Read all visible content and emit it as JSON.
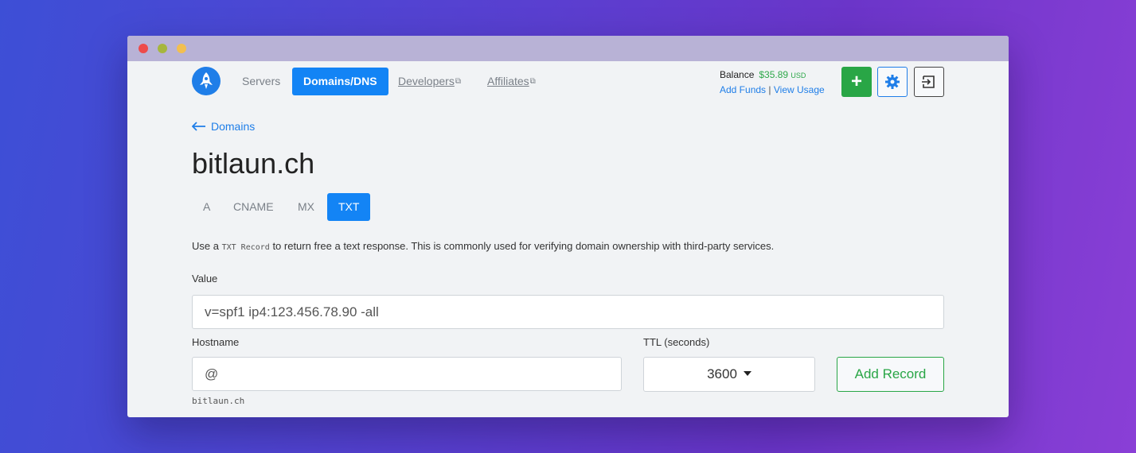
{
  "nav": {
    "servers": "Servers",
    "domains_dns": "Domains/DNS",
    "developers": "Developers",
    "affiliates": "Affiliates"
  },
  "account": {
    "balance_label": "Balance",
    "balance_amount": "$35.89",
    "balance_currency": "USD",
    "add_funds": "Add Funds",
    "separator": "|",
    "view_usage": "View Usage"
  },
  "actions": {
    "add_icon": "plus-icon",
    "settings_icon": "gear-icon",
    "logout_icon": "logout-icon"
  },
  "breadcrumb": {
    "back_label": "Domains"
  },
  "page": {
    "title": "bitlaun.ch"
  },
  "tabs": [
    {
      "label": "A"
    },
    {
      "label": "CNAME"
    },
    {
      "label": "MX"
    },
    {
      "label": "TXT"
    }
  ],
  "description": {
    "prefix": "Use a",
    "code": "TXT Record",
    "suffix": "to return free a text response. This is commonly used for verifying domain ownership with third-party services."
  },
  "form": {
    "value_label": "Value",
    "value": "v=spf1 ip4:123.456.78.90 -all",
    "hostname_label": "Hostname",
    "hostname_value": "@",
    "hostname_hint": "bitlaun.ch",
    "ttl_label": "TTL (seconds)",
    "ttl_value": "3600",
    "submit_label": "Add Record"
  },
  "colors": {
    "primary": "#1384f5",
    "success": "#29a646",
    "background": "#f1f3f5"
  }
}
